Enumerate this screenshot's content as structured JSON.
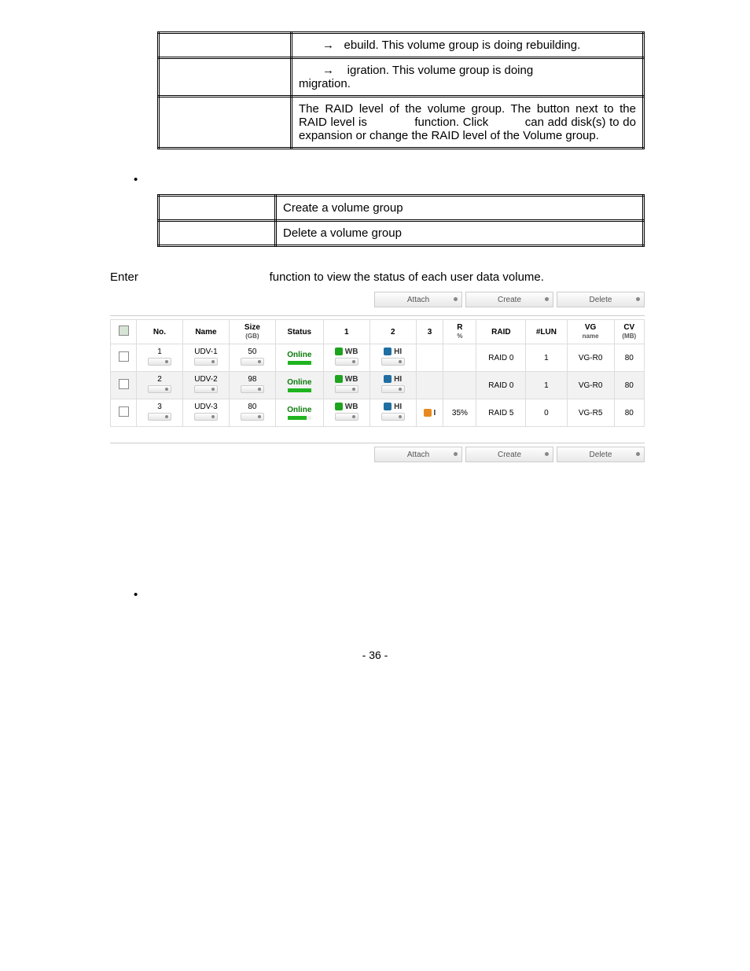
{
  "table1": {
    "r1": "ebuild. This volume group is doing rebuilding.",
    "r2a": "igration. This volume group is doing",
    "r2b": "migration.",
    "r3a": "The RAID level of the volume group. The button next to the RAID level is",
    "r3b": "function. Click",
    "r3c": "can add disk(s) to do expansion or change the RAID level of the Volume group."
  },
  "table2": {
    "r1": "Create a volume group",
    "r2": "Delete a volume group"
  },
  "intro": {
    "pre": "Enter",
    "post": "function to view the status of each user data volume."
  },
  "buttons": {
    "attach": "Attach",
    "create": "Create",
    "delete": "Delete"
  },
  "headers": {
    "no": "No.",
    "name": "Name",
    "size": "Size",
    "size_sub": "(GB)",
    "status": "Status",
    "c1": "1",
    "c2": "2",
    "c3": "3",
    "r": "R",
    "r_sub": "%",
    "raid": "RAID",
    "lun": "#LUN",
    "vg": "VG",
    "vg_sub": "name",
    "cv": "CV",
    "cv_sub": "(MB)"
  },
  "badges": {
    "wb": "WB",
    "hi": "HI",
    "i": "I"
  },
  "rows": [
    {
      "no": "1",
      "name": "UDV-1",
      "size": "50",
      "status": "Online",
      "c3": "",
      "r": "",
      "raid": "RAID 0",
      "lun": "1",
      "vg": "VG-R0",
      "cv": "80"
    },
    {
      "no": "2",
      "name": "UDV-2",
      "size": "98",
      "status": "Online",
      "c3": "",
      "r": "",
      "raid": "RAID 0",
      "lun": "1",
      "vg": "VG-R0",
      "cv": "80"
    },
    {
      "no": "3",
      "name": "UDV-3",
      "size": "80",
      "status": "Online",
      "c3": "I",
      "r": "35%",
      "raid": "RAID 5",
      "lun": "0",
      "vg": "VG-R5",
      "cv": "80"
    }
  ],
  "page": "- 36 -"
}
